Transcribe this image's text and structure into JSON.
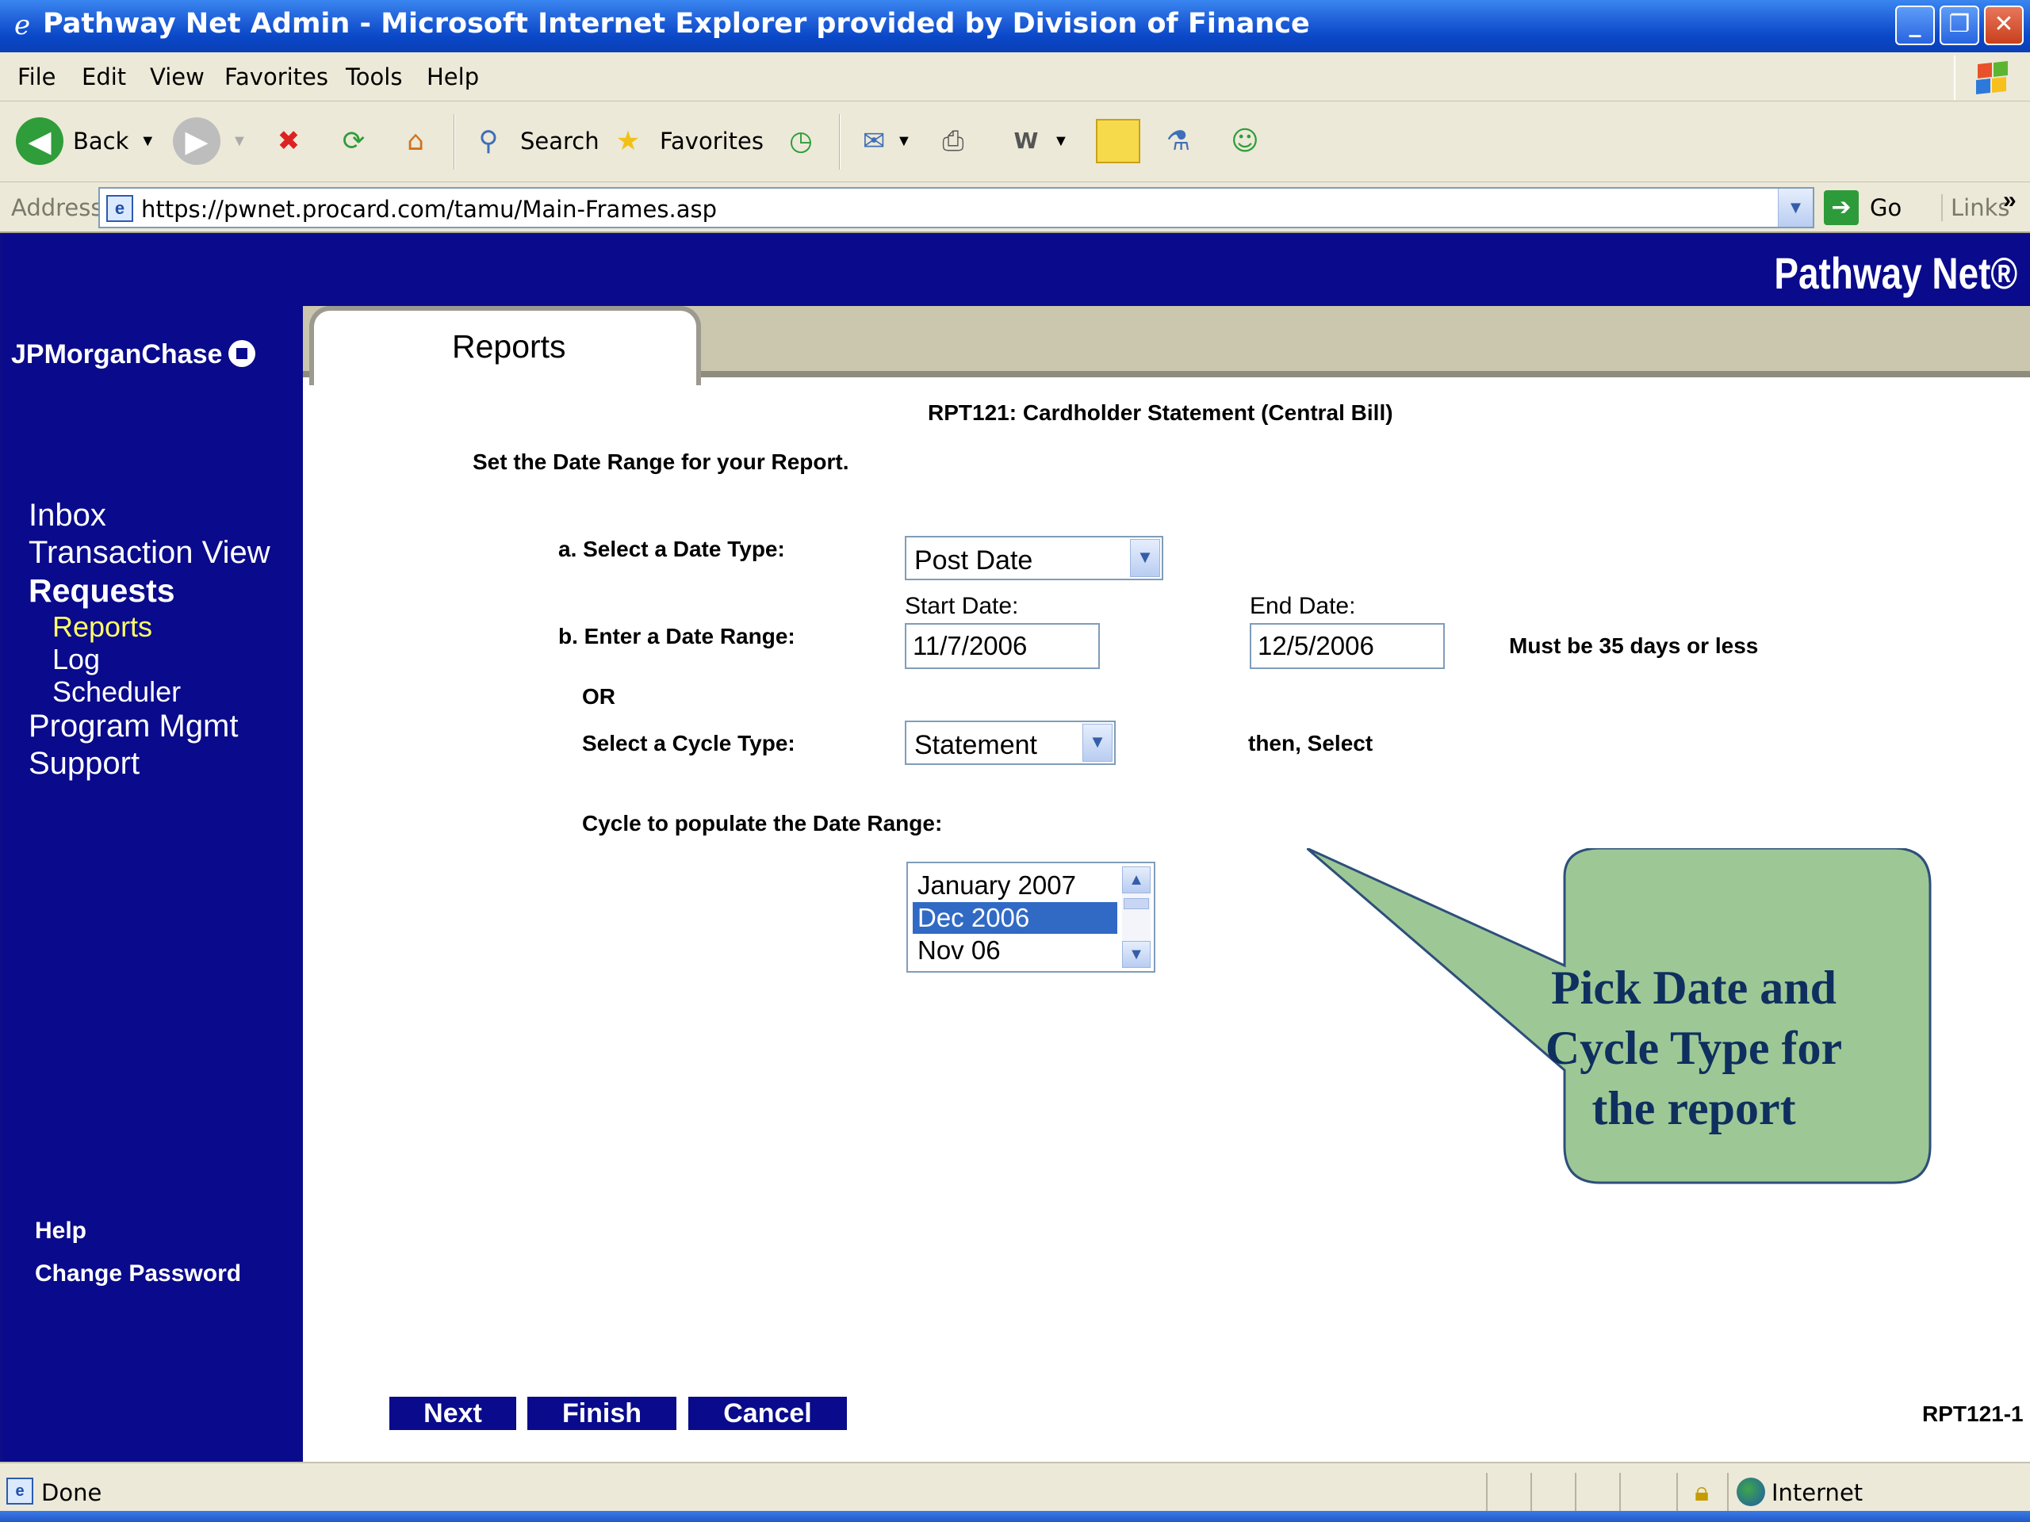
{
  "window": {
    "title": "Pathway Net Admin - Microsoft Internet Explorer provided by Division of Finance"
  },
  "menu": [
    "File",
    "Edit",
    "View",
    "Favorites",
    "Tools",
    "Help"
  ],
  "toolbar": {
    "back": "Back",
    "search": "Search",
    "favorites": "Favorites"
  },
  "address": {
    "label": "Address",
    "url": "https://pwnet.procard.com/tamu/Main-Frames.asp",
    "go": "Go",
    "links": "Links"
  },
  "banner": {
    "brand": "Pathway Net®"
  },
  "sidebar": {
    "bank": "JPMorganChase",
    "nav": [
      {
        "label": "Inbox"
      },
      {
        "label": "Transaction View"
      },
      {
        "label": "Requests"
      },
      {
        "label": "Reports"
      },
      {
        "label": "Log"
      },
      {
        "label": "Scheduler"
      },
      {
        "label": "Program Mgmt"
      },
      {
        "label": "Support"
      }
    ],
    "footer": [
      "Help",
      "Change Password"
    ]
  },
  "tab": {
    "label": "Reports"
  },
  "report": {
    "title": "RPT121: Cardholder Statement (Central Bill)",
    "instruction": "Set the Date Range for your Report.",
    "date_type_label": "a.  Select a Date Type:",
    "date_type_value": "Post Date",
    "date_range_label": "b.  Enter a Date Range:",
    "start_label": "Start Date:",
    "start_value": "11/7/2006",
    "end_label": "End Date:",
    "end_value": "12/5/2006",
    "range_note": "Must be 35 days or less",
    "or": "OR",
    "cycle_type_label": "Select a Cycle Type:",
    "cycle_type_value": "Statement",
    "then_select": "then, Select",
    "cycle_label": "Cycle to populate the Date Range:",
    "cycle_options": [
      "January 2007",
      "Dec 2006",
      "Nov 06"
    ],
    "cycle_selected": "Dec 2006",
    "page_id": "RPT121-1"
  },
  "buttons": {
    "next": "Next",
    "finish": "Finish",
    "cancel": "Cancel"
  },
  "callout": {
    "lines": [
      "Pick Date and",
      "Cycle Type for",
      "the report"
    ],
    "fill": "#9dc896"
  },
  "status": {
    "text": "Done",
    "zone": "Internet"
  },
  "colors": {
    "nav_bg": "#0a0a8c",
    "selected_nav": "#ffff66",
    "list_highlight": "#316ac5"
  }
}
